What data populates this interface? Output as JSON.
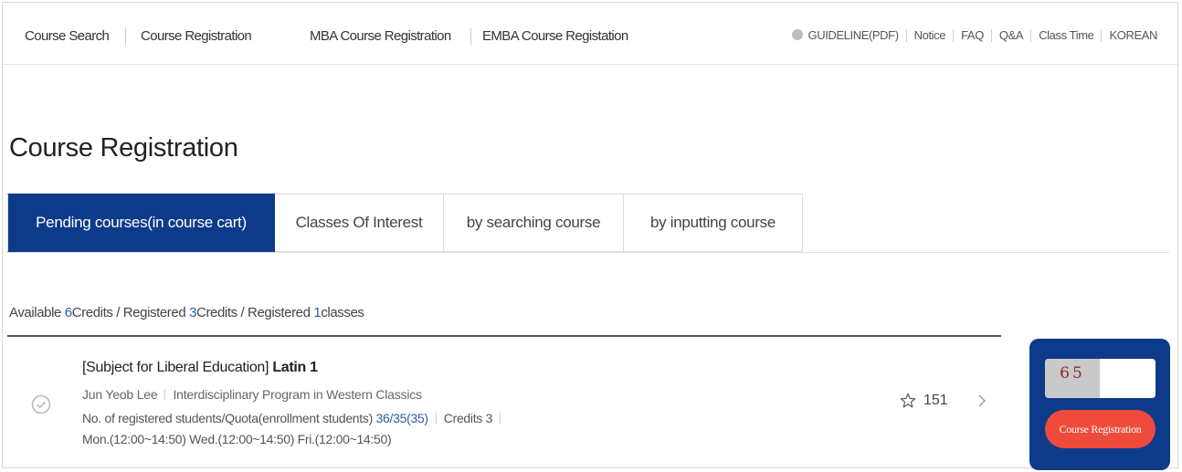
{
  "topnav": {
    "left_items": [
      "Course Search",
      "Course Registration",
      "MBA Course Registration",
      "EMBA Course Registation"
    ],
    "right_items": [
      "GUIDELINE(PDF)",
      "Notice",
      "FAQ",
      "Q&A",
      "Class Time",
      "KOREAN"
    ]
  },
  "page_title": "Course Registration",
  "tabs": [
    {
      "label": "Pending courses(in course cart)",
      "active": true
    },
    {
      "label": "Classes Of Interest",
      "active": false
    },
    {
      "label": "by searching course",
      "active": false
    },
    {
      "label": "by inputting course",
      "active": false
    }
  ],
  "credits": {
    "available_prefix": "Available ",
    "available": "6",
    "available_suffix": "Credits / Registered ",
    "registered_credits": "3",
    "registered_credits_suffix": "Credits / Registered ",
    "registered_classes": "1",
    "registered_classes_suffix": "classes"
  },
  "course": {
    "category": "[Subject for Liberal Education] ",
    "name": "Latin 1",
    "professor": "Jun Yeob Lee",
    "department": "Interdisciplinary Program in Western Classics",
    "registered_label": "No. of registered students/Quota(enrollment students) ",
    "registered_value": "36/35(35)",
    "credits_label": "Credits 3",
    "time": "Mon.(12:00~14:50) Wed.(12:00~14:50) Fri.(12:00~14:50)",
    "interest_count": "151"
  },
  "registration": {
    "captcha_text": "65",
    "input_value": "",
    "button_label": "Course Registration"
  },
  "colors": {
    "primary_navy": "#0d3b8a",
    "accent_red": "#ee4b3d",
    "link_blue": "#2b5aa8"
  },
  "icons": [
    "info-icon",
    "check-circle-icon",
    "star-icon",
    "chevron-right-icon"
  ]
}
